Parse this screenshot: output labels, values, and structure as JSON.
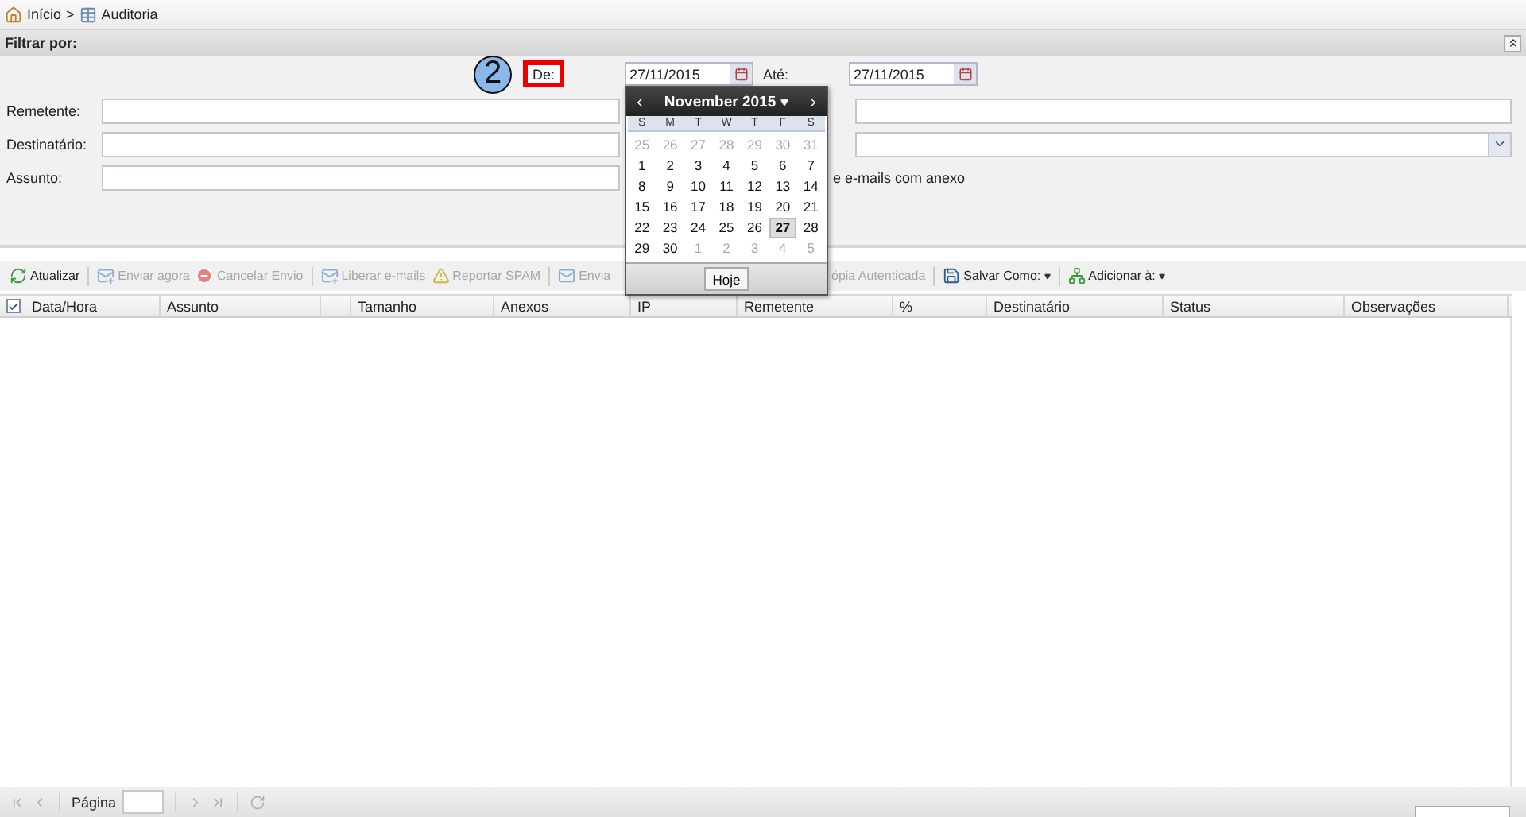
{
  "breadcrumb": {
    "items": [
      {
        "label": "Início"
      },
      {
        "label": "Auditoria"
      }
    ],
    "separator": ">"
  },
  "filter": {
    "title": "Filtrar por:",
    "annotation": "2",
    "from_label": "De:",
    "from_value": "27/11/2015",
    "to_label": "Até:",
    "to_value": "27/11/2015",
    "rows": [
      {
        "label": "Remetente:",
        "kind": "text"
      },
      {
        "label": "Destinatário:",
        "kind": "select"
      },
      {
        "label": "Assunto:",
        "kind": "attachment"
      }
    ],
    "attachment_text": "e e-mails com anexo"
  },
  "calendar": {
    "title": "November 2015",
    "weekdays": [
      "S",
      "M",
      "T",
      "W",
      "T",
      "F",
      "S"
    ],
    "weeks": [
      [
        {
          "day": "25",
          "current": false,
          "selected": false
        },
        {
          "day": "26",
          "current": false,
          "selected": false
        },
        {
          "day": "27",
          "current": false,
          "selected": false
        },
        {
          "day": "28",
          "current": false,
          "selected": false
        },
        {
          "day": "29",
          "current": false,
          "selected": false
        },
        {
          "day": "30",
          "current": false,
          "selected": false
        },
        {
          "day": "31",
          "current": false,
          "selected": false
        }
      ],
      [
        {
          "day": "1",
          "current": true,
          "selected": false
        },
        {
          "day": "2",
          "current": true,
          "selected": false
        },
        {
          "day": "3",
          "current": true,
          "selected": false
        },
        {
          "day": "4",
          "current": true,
          "selected": false
        },
        {
          "day": "5",
          "current": true,
          "selected": false
        },
        {
          "day": "6",
          "current": true,
          "selected": false
        },
        {
          "day": "7",
          "current": true,
          "selected": false
        }
      ],
      [
        {
          "day": "8",
          "current": true,
          "selected": false
        },
        {
          "day": "9",
          "current": true,
          "selected": false
        },
        {
          "day": "10",
          "current": true,
          "selected": false
        },
        {
          "day": "11",
          "current": true,
          "selected": false
        },
        {
          "day": "12",
          "current": true,
          "selected": false
        },
        {
          "day": "13",
          "current": true,
          "selected": false
        },
        {
          "day": "14",
          "current": true,
          "selected": false
        }
      ],
      [
        {
          "day": "15",
          "current": true,
          "selected": false
        },
        {
          "day": "16",
          "current": true,
          "selected": false
        },
        {
          "day": "17",
          "current": true,
          "selected": false
        },
        {
          "day": "18",
          "current": true,
          "selected": false
        },
        {
          "day": "19",
          "current": true,
          "selected": false
        },
        {
          "day": "20",
          "current": true,
          "selected": false
        },
        {
          "day": "21",
          "current": true,
          "selected": false
        }
      ],
      [
        {
          "day": "22",
          "current": true,
          "selected": false
        },
        {
          "day": "23",
          "current": true,
          "selected": false
        },
        {
          "day": "24",
          "current": true,
          "selected": false
        },
        {
          "day": "25",
          "current": true,
          "selected": false
        },
        {
          "day": "26",
          "current": true,
          "selected": false
        },
        {
          "day": "27",
          "current": true,
          "selected": true
        },
        {
          "day": "28",
          "current": true,
          "selected": false
        }
      ],
      [
        {
          "day": "29",
          "current": true,
          "selected": false
        },
        {
          "day": "30",
          "current": true,
          "selected": false
        },
        {
          "day": "1",
          "current": false,
          "selected": false
        },
        {
          "day": "2",
          "current": false,
          "selected": false
        },
        {
          "day": "3",
          "current": false,
          "selected": false
        },
        {
          "day": "4",
          "current": false,
          "selected": false
        },
        {
          "day": "5",
          "current": false,
          "selected": false
        }
      ]
    ],
    "today_button": "Hoje"
  },
  "toolbar": [
    {
      "label": "Atualizar",
      "kind": "refresh",
      "disabled": false,
      "separator_after": true,
      "dropdown": false
    },
    {
      "label": "Enviar agora",
      "kind": "mail-send",
      "disabled": true,
      "separator_after": false,
      "dropdown": false
    },
    {
      "label": "Cancelar Envio",
      "kind": "cancel",
      "disabled": true,
      "separator_after": true,
      "dropdown": false
    },
    {
      "label": "Liberar e-mails",
      "kind": "mail-send",
      "disabled": true,
      "separator_after": false,
      "dropdown": false
    },
    {
      "label": "Reportar SPAM",
      "kind": "warning",
      "disabled": true,
      "separator_after": true,
      "dropdown": false
    },
    {
      "label": "Envia",
      "kind": "mail",
      "disabled": true,
      "separator_after": false,
      "dropdown": false
    },
    {
      "label": "ópia Autenticada",
      "kind": "gap",
      "disabled": true,
      "separator_after": true,
      "dropdown": false
    },
    {
      "label": "Salvar Como:",
      "kind": "save",
      "disabled": false,
      "separator_after": true,
      "dropdown": true
    },
    {
      "label": "Adicionar à:",
      "kind": "tree",
      "disabled": false,
      "separator_after": false,
      "dropdown": true
    }
  ],
  "table": {
    "select_all_checked": true,
    "columns": [
      {
        "label": "Data/Hora"
      },
      {
        "label": "Assunto"
      },
      {},
      {
        "label": "Tamanho"
      },
      {
        "label": "Anexos"
      },
      {
        "label": "IP"
      },
      {
        "label": "Remetente"
      },
      {
        "label": "%"
      },
      {
        "label": "Destinatário"
      },
      {
        "label": "Status"
      },
      {
        "label": "Observações"
      }
    ]
  },
  "pager": {
    "page_label": "Página"
  }
}
